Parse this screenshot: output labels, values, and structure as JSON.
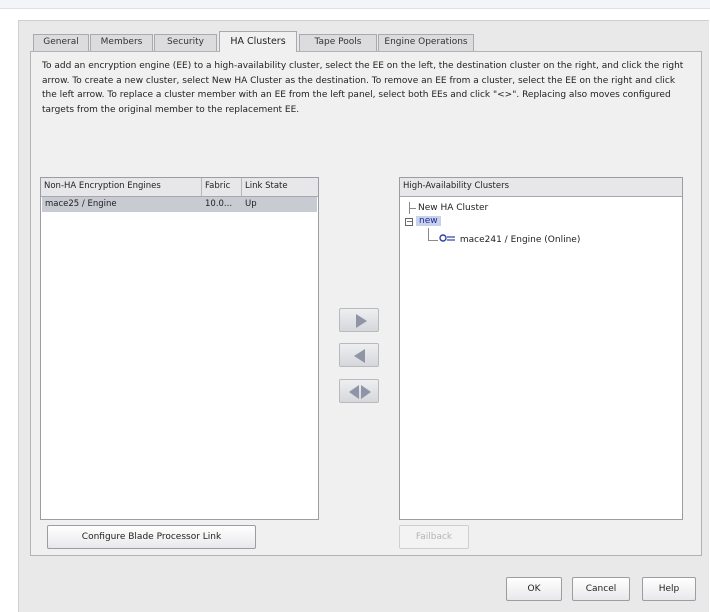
{
  "tabs": [
    {
      "label": "General"
    },
    {
      "label": "Members"
    },
    {
      "label": "Security"
    },
    {
      "label": "HA Clusters"
    },
    {
      "label": "Tape Pools"
    },
    {
      "label": "Engine Operations"
    }
  ],
  "active_tab": "HA Clusters",
  "description": "To add an encryption engine (EE) to a high-availability cluster, select the EE on the left, the destination cluster on the right, and click the right arrow. To create a new cluster, select New HA Cluster as the destination. To remove an EE from a cluster, select the EE on the right and click the left arrow.  To replace a cluster member with an EE from the left panel, select both EEs and click \"<>\". Replacing also moves configured targets from the original member to the replacement EE.",
  "left_table": {
    "columns": [
      "Non-HA Encryption Engines",
      "Fabric",
      "Link State"
    ],
    "rows": [
      {
        "engine": "mace25 / Engine",
        "fabric": "10.0...",
        "link_state": "Up"
      }
    ]
  },
  "right_tree": {
    "header": "High-Availability Clusters",
    "new_cluster_label": "New HA Cluster",
    "cluster": {
      "name": "new",
      "expanded": true,
      "members": [
        {
          "label": "mace241 / Engine (Online)"
        }
      ]
    }
  },
  "arrow_buttons": {
    "right": {
      "icon": "arrow-right-icon"
    },
    "left": {
      "icon": "arrow-left-icon"
    },
    "replace": {
      "icon": "arrow-left-right-icon"
    }
  },
  "buttons": {
    "configure_link": "Configure Blade Processor Link",
    "failback": "Failback",
    "ok": "OK",
    "cancel": "Cancel",
    "help": "Help"
  },
  "colors": {
    "selection": "#c9cbd3",
    "arrow": "#8f95a6",
    "tree_selection_text": "#1a2a9a"
  }
}
